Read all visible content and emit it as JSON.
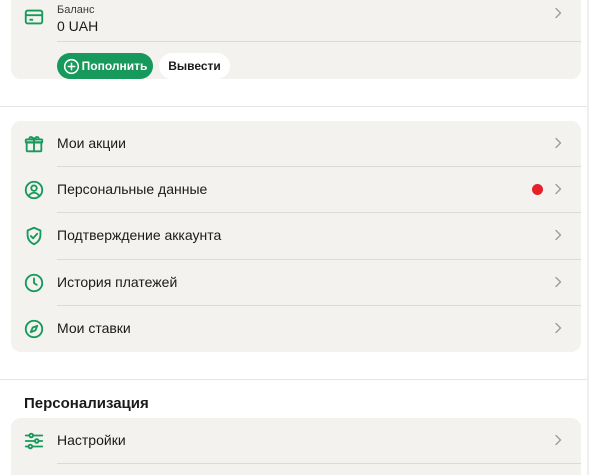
{
  "balance": {
    "caption": "Баланс",
    "value": "0 UAH",
    "topup_label": "Пополнить",
    "withdraw_label": "Вывести"
  },
  "menu": {
    "items": [
      {
        "label": "Мои акции",
        "icon": "gift-icon"
      },
      {
        "label": "Персональные данные",
        "icon": "user-circle-icon",
        "has_notification": true
      },
      {
        "label": "Подтверждение аккаунта",
        "icon": "shield-check-icon"
      },
      {
        "label": "История платежей",
        "icon": "clock-icon"
      },
      {
        "label": "Мои ставки",
        "icon": "compass-icon"
      }
    ]
  },
  "personalization": {
    "title": "Персонализация",
    "items": [
      {
        "label": "Настройки",
        "icon": "sliders-icon"
      }
    ]
  },
  "colors": {
    "accent": "#16995a",
    "notification": "#e8202a",
    "card_background": "#f3f2ee"
  }
}
